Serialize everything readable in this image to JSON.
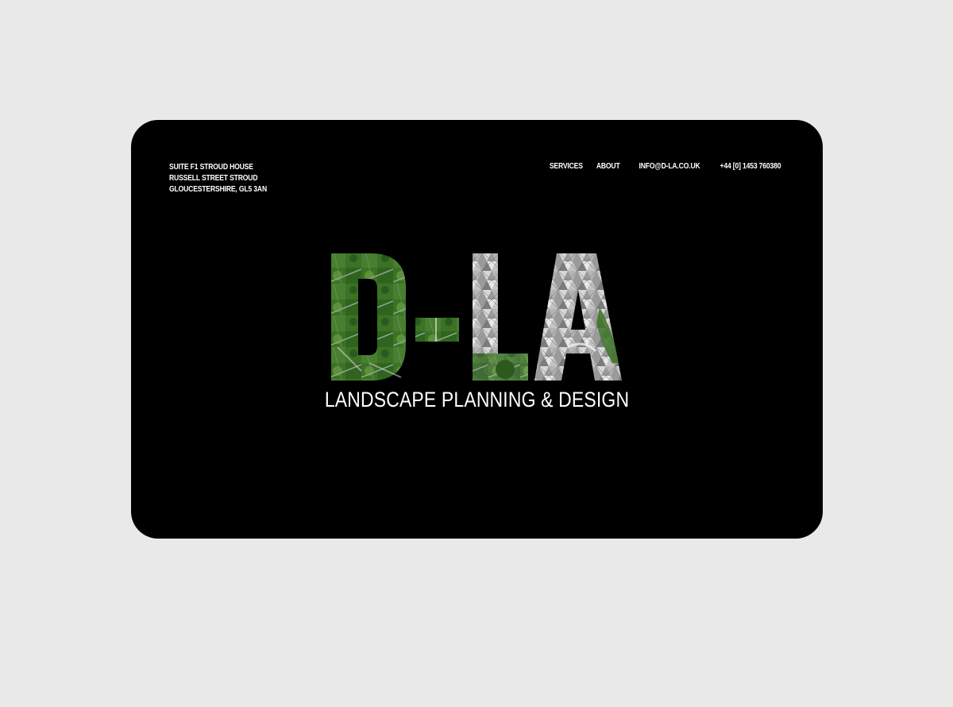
{
  "header": {
    "address_lines": [
      "SUITE F1 STROUD HOUSE",
      "RUSSELL STREET STROUD",
      "GLOUCESTERSHIRE, GL5 3AN"
    ],
    "nav": [
      {
        "label": "SERVICES"
      },
      {
        "label": "ABOUT"
      },
      {
        "label": "INFO@D-LA.CO.UK"
      },
      {
        "label": "+44 [0] 1453 760380"
      }
    ]
  },
  "hero": {
    "logo_text": "D-LA",
    "tagline": "LANDSCAPE PLANNING & DESIGN"
  },
  "colors": {
    "page_background": "#e9e9e9",
    "screen_background": "#000000",
    "text": "#ffffff",
    "logo_green": "#3f7a2a",
    "logo_grey": "#a9a9a9"
  }
}
